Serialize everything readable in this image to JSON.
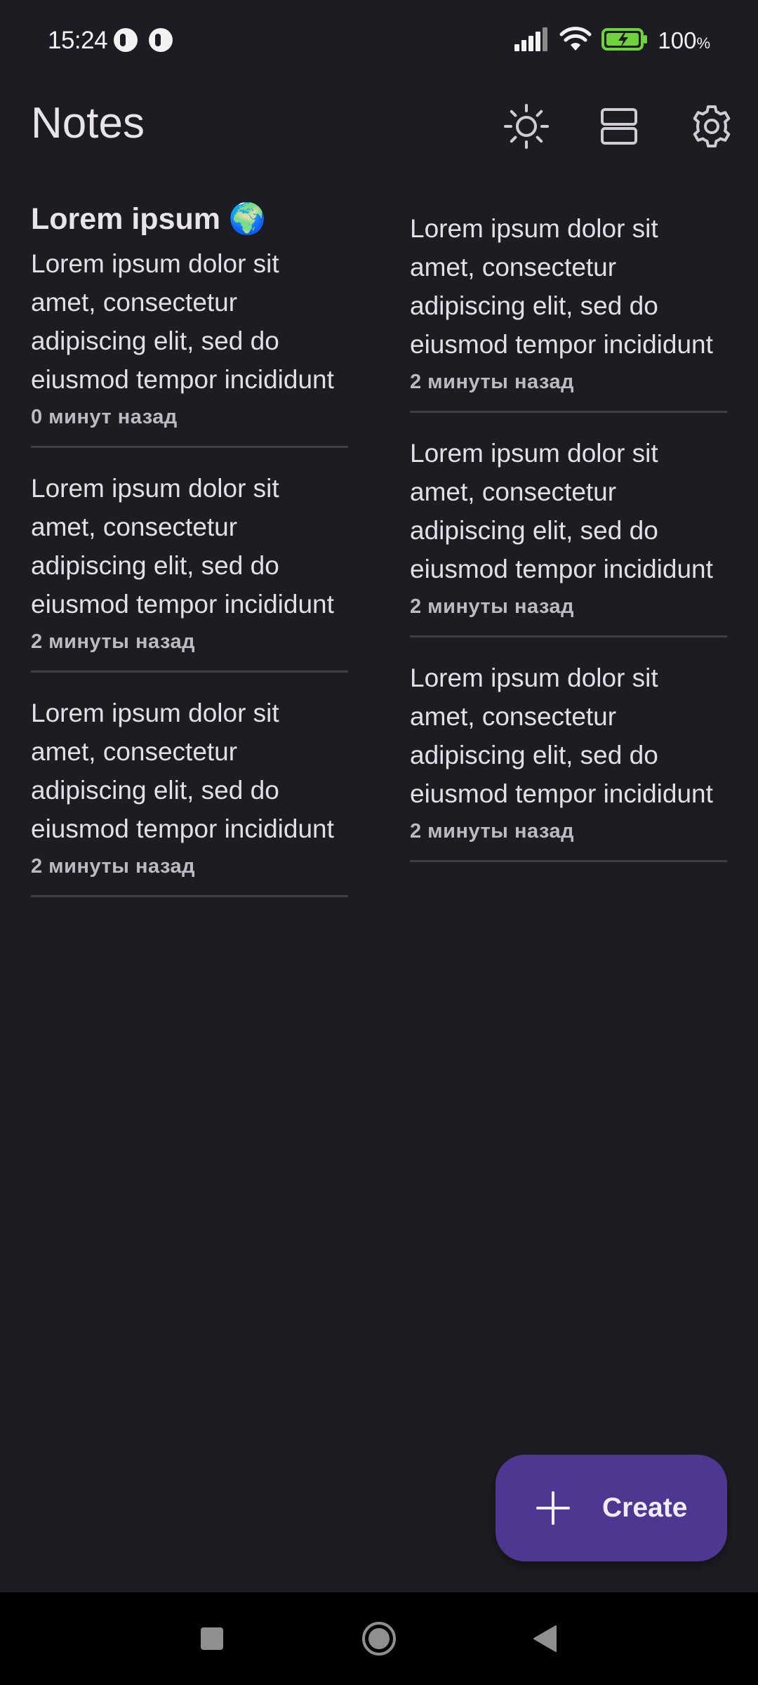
{
  "status_bar": {
    "time": "15:24",
    "battery_percent": "100",
    "battery_unit": "%",
    "icons": [
      "app-notification-icon",
      "app-notification-icon",
      "signal-icon",
      "wifi-icon",
      "battery-charging-icon"
    ]
  },
  "app_bar": {
    "title": "Notes",
    "actions": [
      "theme-icon",
      "layout-icon",
      "settings-icon"
    ]
  },
  "notes": {
    "left": [
      {
        "title": "Lorem ipsum 🌍",
        "body": "Lorem ipsum dolor sit amet, consectetur adipiscing elit, sed do eiusmod tempor incididunt",
        "time": "0 минут назад"
      },
      {
        "title": "",
        "body": "Lorem ipsum dolor sit amet, consectetur adipiscing elit, sed do eiusmod tempor incididunt",
        "time": "2 минуты назад"
      },
      {
        "title": "",
        "body": "Lorem ipsum dolor sit amet, consectetur adipiscing elit, sed do eiusmod tempor incididunt",
        "time": "2 минуты назад"
      }
    ],
    "right": [
      {
        "title": "",
        "body": "Lorem ipsum dolor sit amet, consectetur adipiscing elit, sed do eiusmod tempor incididunt",
        "time": "2 минуты назад"
      },
      {
        "title": "",
        "body": "Lorem ipsum dolor sit amet, consectetur adipiscing elit, sed do eiusmod tempor incididunt",
        "time": "2 минуты назад"
      },
      {
        "title": "",
        "body": "Lorem ipsum dolor sit amet, consectetur adipiscing elit, sed do eiusmod tempor incididunt",
        "time": "2 минуты назад"
      }
    ]
  },
  "fab": {
    "label": "Create",
    "icon": "plus-icon"
  },
  "nav_bar": {
    "buttons": [
      "recents-icon",
      "home-icon",
      "back-icon"
    ]
  },
  "colors": {
    "background": "#1d1c22",
    "fab": "#4e3790",
    "divider": "#3f3e45",
    "battery": "#6fd13b"
  }
}
